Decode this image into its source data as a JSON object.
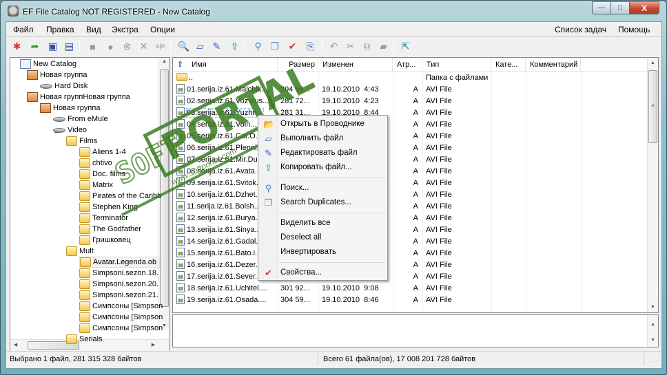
{
  "window": {
    "title": "EF File Catalog NOT REGISTERED - New Catalog",
    "buttons": {
      "minimize": "—",
      "maximize": "□",
      "close": "X"
    }
  },
  "menubar": {
    "left": [
      "Файл",
      "Правка",
      "Вид",
      "Экстра",
      "Опции"
    ],
    "right": [
      "Список задач",
      "Помощь"
    ]
  },
  "toolbar": {
    "buttons": [
      {
        "name": "new-catalog-icon",
        "glyph": "✱",
        "enabled": true
      },
      {
        "name": "open-catalog-icon",
        "glyph": "➦",
        "enabled": true
      },
      {
        "name": "save-icon",
        "glyph": "▣",
        "enabled": true
      },
      {
        "name": "save-all-icon",
        "glyph": "▤",
        "enabled": true
      },
      {
        "name": "add-disk-icon",
        "glyph": "■",
        "enabled": false
      },
      {
        "name": "update-disk-icon",
        "glyph": "●",
        "enabled": false
      },
      {
        "name": "stop-icon",
        "glyph": "⊗",
        "enabled": false
      },
      {
        "name": "delete-icon",
        "glyph": "✕",
        "enabled": false
      },
      {
        "name": "rename-icon",
        "glyph": "a|e",
        "enabled": false
      },
      {
        "name": "open-in-explorer-icon",
        "glyph": "🔍",
        "enabled": true
      },
      {
        "name": "run-file-icon",
        "glyph": "▱",
        "enabled": true
      },
      {
        "name": "edit-file-icon",
        "glyph": "✎",
        "enabled": true
      },
      {
        "name": "copy-file-icon",
        "glyph": "⇪",
        "enabled": true
      },
      {
        "name": "search-icon",
        "glyph": "⚲",
        "enabled": true
      },
      {
        "name": "search-duplicates-icon",
        "glyph": "❐",
        "enabled": true
      },
      {
        "name": "properties-icon",
        "glyph": "✔",
        "enabled": true
      },
      {
        "name": "copy-path-icon",
        "glyph": "⎘",
        "enabled": true
      },
      {
        "name": "undo-icon",
        "glyph": "↶",
        "enabled": false
      },
      {
        "name": "cut-icon",
        "glyph": "✂",
        "enabled": false
      },
      {
        "name": "copy-icon",
        "glyph": "⧉",
        "enabled": false
      },
      {
        "name": "paste-icon",
        "glyph": "▰",
        "enabled": false
      },
      {
        "name": "export-icon",
        "glyph": "⇱",
        "enabled": true
      }
    ]
  },
  "tree": {
    "nodes": [
      {
        "label": "New Catalog",
        "icon": "catalog-icon",
        "level": 0,
        "expander": ""
      },
      {
        "label": "Новая группа",
        "icon": "group-icon",
        "level": 1,
        "expander": "◢"
      },
      {
        "label": "Hard Disk",
        "icon": "disk-icon",
        "level": 2,
        "expander": ""
      },
      {
        "label": "Новая группНовая группа",
        "icon": "group-icon",
        "level": 1,
        "expander": "◢"
      },
      {
        "label": "Новая группа",
        "icon": "group-icon",
        "level": 2,
        "expander": "◢"
      },
      {
        "label": "From eMule",
        "icon": "disk-icon",
        "level": 3,
        "expander": ""
      },
      {
        "label": "Video",
        "icon": "disk-icon",
        "level": 3,
        "expander": "◢"
      },
      {
        "label": "Films",
        "icon": "folder-icon",
        "level": 4,
        "expander": "◢"
      },
      {
        "label": "Aliens 1-4",
        "icon": "folder-icon",
        "level": 5,
        "expander": ""
      },
      {
        "label": "chtivo",
        "icon": "folder-icon",
        "level": 5,
        "expander": ""
      },
      {
        "label": "Doc. films",
        "icon": "folder-icon",
        "level": 5,
        "expander": "▷"
      },
      {
        "label": "Matrix",
        "icon": "folder-icon",
        "level": 5,
        "expander": ""
      },
      {
        "label": "Pirates of the Caribb",
        "icon": "folder-icon",
        "level": 5,
        "expander": ""
      },
      {
        "label": "Stephen King",
        "icon": "folder-icon",
        "level": 5,
        "expander": ""
      },
      {
        "label": "Terminator",
        "icon": "folder-icon",
        "level": 5,
        "expander": ""
      },
      {
        "label": "The Godfather",
        "icon": "folder-icon",
        "level": 5,
        "expander": ""
      },
      {
        "label": "Гришковец",
        "icon": "folder-icon",
        "level": 5,
        "expander": ""
      },
      {
        "label": "Mult",
        "icon": "folder-icon",
        "level": 4,
        "expander": "◢"
      },
      {
        "label": "Avatar.Legenda.ob",
        "icon": "folder-icon",
        "level": 5,
        "expander": "",
        "selected": true
      },
      {
        "label": "Simpsoni.sezon.18.",
        "icon": "folder-icon",
        "level": 5,
        "expander": ""
      },
      {
        "label": "Simpsoni.sezon.20.",
        "icon": "folder-icon",
        "level": 5,
        "expander": ""
      },
      {
        "label": "Simpsoni.sezon.21.",
        "icon": "folder-icon",
        "level": 5,
        "expander": ""
      },
      {
        "label": "Симпсоны [Simpson",
        "icon": "folder-icon",
        "level": 5,
        "expander": ""
      },
      {
        "label": "Симпсоны [Simpson",
        "icon": "folder-icon",
        "level": 5,
        "expander": ""
      },
      {
        "label": "Симпсоны [Simpson",
        "icon": "folder-icon",
        "level": 5,
        "expander": ""
      },
      {
        "label": "Serials",
        "icon": "folder-icon",
        "level": 4,
        "expander": "▷"
      }
    ]
  },
  "list": {
    "columns": [
      "Имя",
      "Размер",
      "Изменен",
      "Атр...",
      "Тип",
      "Кате...",
      "Комментарий"
    ],
    "rows": [
      {
        "name": "..",
        "size": "",
        "modified": "",
        "attr": "",
        "type": "Папка с файлами",
        "up": true
      },
      {
        "name": "01.serija.iz.61.Malchik....",
        "size": "294 66...",
        "modified": "19.10.2010  4:43",
        "attr": "A",
        "type": "AVI File"
      },
      {
        "name": "02.serija.iz.61.Vozvrus...",
        "size": "281 72...",
        "modified": "19.10.2010  4:23",
        "attr": "A",
        "type": "AVI File"
      },
      {
        "name": "03.serija.iz.61.Yuzhn...",
        "size": "281 31...",
        "modified": "19.10.2010  8:44",
        "attr": "A",
        "type": "AVI File",
        "selected": true
      },
      {
        "name": "04.serija.iz.61.Voin...",
        "size": "",
        "modified": "",
        "attr": "A",
        "type": "AVI File"
      },
      {
        "name": "05.serija.iz.61.Car.O...",
        "size": "",
        "modified": "",
        "attr": "A",
        "type": "AVI File"
      },
      {
        "name": "06.serija.iz.61.Plenni...",
        "size": "",
        "modified": "",
        "attr": "A",
        "type": "AVI File"
      },
      {
        "name": "07.serija.iz.61.Mir.Du...",
        "size": "",
        "modified": "",
        "attr": "A",
        "type": "AVI File"
      },
      {
        "name": "08.serija.iz.61.Avata...",
        "size": "",
        "modified": "",
        "attr": "A",
        "type": "AVI File"
      },
      {
        "name": "09.serija.iz.61.Svitok...",
        "size": "",
        "modified": "",
        "attr": "A",
        "type": "AVI File"
      },
      {
        "name": "10.serija.iz.61.Dzhet...",
        "size": "",
        "modified": "",
        "attr": "A",
        "type": "AVI File"
      },
      {
        "name": "11.serija.iz.61.Bolsh...",
        "size": "",
        "modified": "",
        "attr": "A",
        "type": "AVI File"
      },
      {
        "name": "12.serija.iz.61.Burya...",
        "size": "",
        "modified": "",
        "attr": "A",
        "type": "AVI File"
      },
      {
        "name": "13.serija.iz.61.Sinya...",
        "size": "",
        "modified": "",
        "attr": "A",
        "type": "AVI File"
      },
      {
        "name": "14.serija.iz.61.Gadal...",
        "size": "",
        "modified": "",
        "attr": "A",
        "type": "AVI File"
      },
      {
        "name": "15.serija.iz.61.Bato.i...",
        "size": "",
        "modified": "",
        "attr": "A",
        "type": "AVI File"
      },
      {
        "name": "16.serija.iz.61.Dezer...",
        "size": "",
        "modified": "",
        "attr": "A",
        "type": "AVI File"
      },
      {
        "name": "17.serija.iz.61.Sever....",
        "size": "",
        "modified": "",
        "attr": "A",
        "type": "AVI File"
      },
      {
        "name": "18.serija.iz.61.Uchitel....",
        "size": "301 92...",
        "modified": "19.10.2010  9:08",
        "attr": "A",
        "type": "AVI File"
      },
      {
        "name": "19.serija.iz.61.Osada....",
        "size": "304 59...",
        "modified": "19.10.2010  8:46",
        "attr": "A",
        "type": "AVI File"
      }
    ]
  },
  "context_menu": {
    "items": [
      {
        "label": "Открыть в Проводнике",
        "icon": "open-in-explorer-icon",
        "glyph": "📂"
      },
      {
        "label": "Выполнить файл",
        "icon": "run-file-icon",
        "glyph": "▱"
      },
      {
        "label": "Редактировать файл",
        "icon": "edit-file-icon",
        "glyph": "✎"
      },
      {
        "label": "Копировать файл...",
        "icon": "copy-file-icon",
        "glyph": "⇪"
      },
      {
        "separator": true
      },
      {
        "label": "Поиск...",
        "icon": "search-icon",
        "glyph": "⚲"
      },
      {
        "label": "Search Duplicates...",
        "icon": "search-duplicates-icon",
        "glyph": "❐"
      },
      {
        "separator": true
      },
      {
        "label": "Виделить все",
        "icon": "",
        "glyph": ""
      },
      {
        "label": "Deselect all",
        "icon": "",
        "glyph": ""
      },
      {
        "label": "Инвертировать",
        "icon": "",
        "glyph": ""
      },
      {
        "separator": true
      },
      {
        "label": "Свойства...",
        "icon": "properties-icon",
        "glyph": "✔"
      }
    ]
  },
  "watermark": {
    "word": "PORTAL",
    "prefix": "SOFT",
    "url": "www.softportal.com",
    "tm": "TM"
  },
  "statusbar": {
    "left": "Выбрано 1 файл, 281 315 328 байтов",
    "right": "Всего 61 файла(ов), 17 008 201 728 байтов"
  }
}
